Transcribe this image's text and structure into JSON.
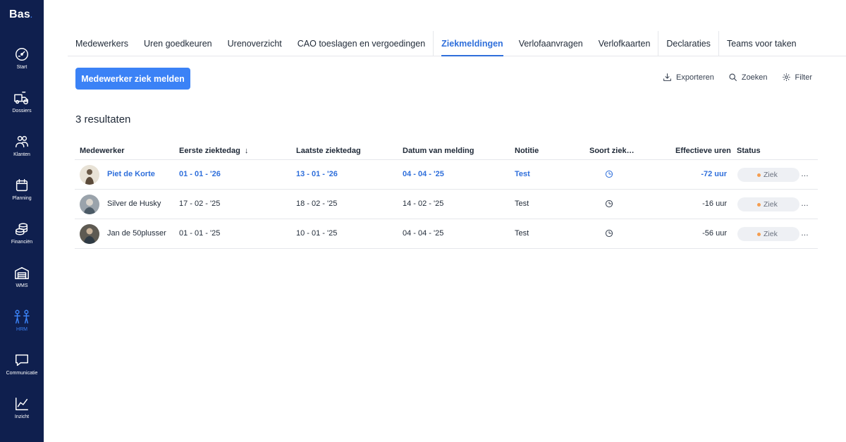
{
  "app": {
    "logo": "Bas",
    "logo_dot": "."
  },
  "sidebar": {
    "items": [
      {
        "label": "Start",
        "icon": "gauge-icon",
        "active": false
      },
      {
        "label": "Dossiers",
        "icon": "truck-icon",
        "active": false
      },
      {
        "label": "Klanten",
        "icon": "customers-icon",
        "active": false
      },
      {
        "label": "Planning",
        "icon": "calendar-icon",
        "active": false
      },
      {
        "label": "Financiën",
        "icon": "coins-icon",
        "active": false
      },
      {
        "label": "WMS",
        "icon": "warehouse-icon",
        "active": false
      },
      {
        "label": "HRM",
        "icon": "people-icon",
        "active": true
      },
      {
        "label": "Communicatie",
        "icon": "chat-icon",
        "active": false
      },
      {
        "label": "Inzicht",
        "icon": "chart-icon",
        "active": false
      }
    ]
  },
  "tabs": [
    {
      "label": "Medewerkers"
    },
    {
      "label": "Uren goedkeuren"
    },
    {
      "label": "Urenoverzicht"
    },
    {
      "label": "CAO toeslagen en vergoedingen"
    },
    {
      "label": "Ziekmeldingen",
      "active": true
    },
    {
      "label": "Verlofaanvragen"
    },
    {
      "label": "Verlofkaarten"
    },
    {
      "label": "Declaraties"
    },
    {
      "label": "Teams voor taken"
    }
  ],
  "toolbar": {
    "primary_label": "Medewerker ziek melden",
    "export_label": "Exporteren",
    "search_label": "Zoeken",
    "filter_label": "Filter"
  },
  "results_label": "3 resultaten",
  "table": {
    "columns": {
      "medewerker": "Medewerker",
      "eerste": "Eerste ziektedag",
      "laatste": "Laatste ziektedag",
      "datum": "Datum van melding",
      "notitie": "Notitie",
      "soort": "Soort ziek…",
      "uren": "Effectieve uren",
      "status": "Status"
    },
    "sort_icon": "arrow-down-icon",
    "rows": [
      {
        "name": "Piet de Korte",
        "eerste": "01 - 01 - '26",
        "laatste": "13 - 01 - '26",
        "datum": "04 - 04 - '25",
        "notitie": "Test",
        "uren": "-72 uur",
        "status": "Ziek",
        "more": "…"
      },
      {
        "name": "Silver de Husky",
        "eerste": "17 - 02 - '25",
        "laatste": "18 - 02 - '25",
        "datum": "14 - 02 - '25",
        "notitie": "Test",
        "uren": "-16 uur",
        "status": "Ziek",
        "more": "…"
      },
      {
        "name": "Jan de 50plusser",
        "eerste": "01 - 01 - '25",
        "laatste": "10 - 01 - '25",
        "datum": "04 - 04 - '25",
        "notitie": "Test",
        "uren": "-56 uur",
        "status": "Ziek",
        "more": "…"
      }
    ]
  },
  "colors": {
    "sidebar": "#0f1f4e",
    "accent": "#3b82f6",
    "link": "#2f6fdb",
    "status_dot": "#f59e51",
    "badge_bg": "#eef0f4"
  }
}
